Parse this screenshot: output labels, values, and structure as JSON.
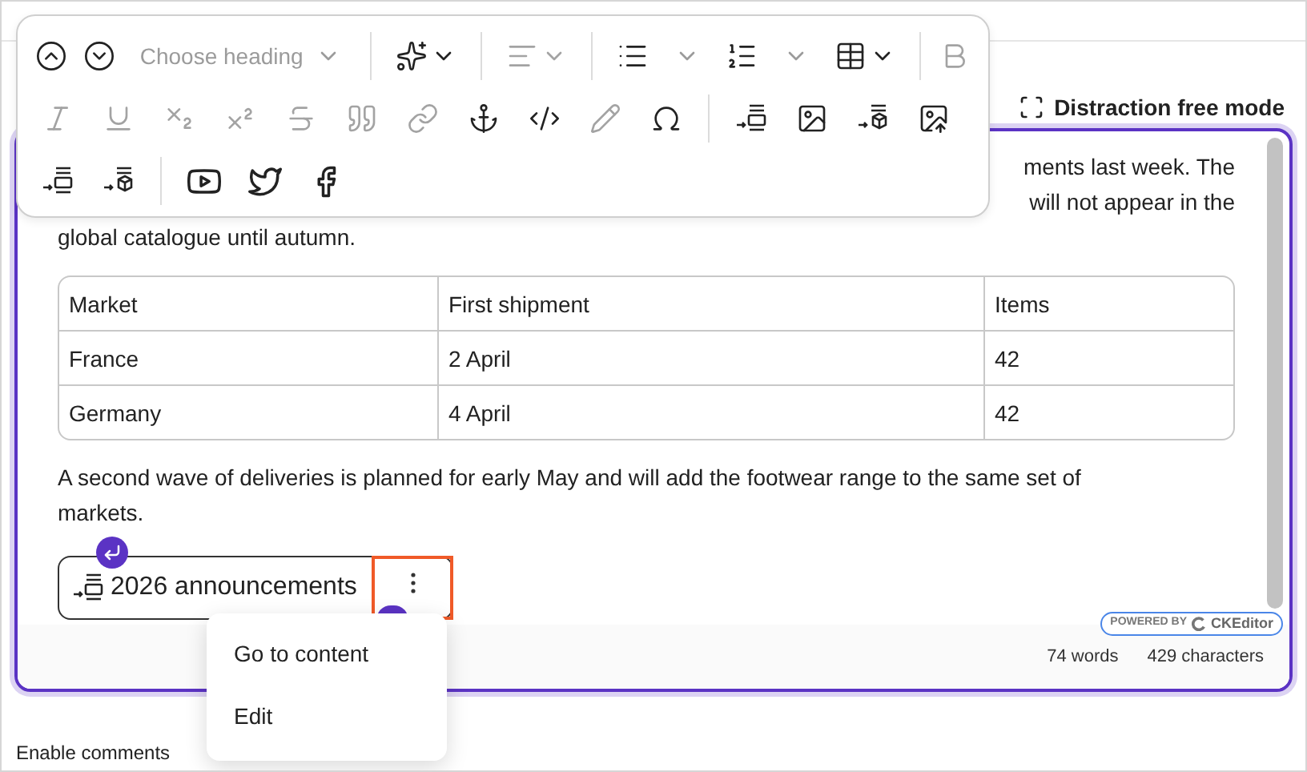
{
  "toolbar": {
    "rows": [
      [
        {
          "kind": "previous",
          "disabled": false
        },
        {
          "kind": "next",
          "disabled": false
        },
        {
          "kind": "heading",
          "placeholder": "Choose heading",
          "disabled": true
        },
        {
          "kind": "separator"
        },
        {
          "kind": "ai",
          "disabled": false
        },
        {
          "kind": "separator"
        },
        {
          "kind": "align",
          "disabled": true
        },
        {
          "kind": "separator"
        },
        {
          "kind": "bulleted-list",
          "disabled": false
        },
        {
          "kind": "numbered-list",
          "disabled": false
        },
        {
          "kind": "table",
          "disabled": false
        },
        {
          "kind": "separator"
        },
        {
          "kind": "bold",
          "disabled": true
        }
      ],
      [
        {
          "kind": "italic",
          "disabled": true
        },
        {
          "kind": "underline",
          "disabled": true
        },
        {
          "kind": "subscript",
          "disabled": true
        },
        {
          "kind": "superscript",
          "disabled": true
        },
        {
          "kind": "strikethrough",
          "disabled": true
        },
        {
          "kind": "quote",
          "disabled": true
        },
        {
          "kind": "link",
          "disabled": true
        },
        {
          "kind": "anchor",
          "disabled": false
        },
        {
          "kind": "code",
          "disabled": false
        },
        {
          "kind": "edit",
          "disabled": true
        },
        {
          "kind": "special-characters",
          "disabled": false
        },
        {
          "kind": "separator"
        },
        {
          "kind": "insert-section",
          "disabled": false
        },
        {
          "kind": "image",
          "disabled": false
        },
        {
          "kind": "insert-block",
          "disabled": false
        },
        {
          "kind": "upload-image",
          "disabled": false
        }
      ],
      [
        {
          "kind": "insert-section-inline",
          "disabled": false
        },
        {
          "kind": "insert-block-inline",
          "disabled": false
        },
        {
          "kind": "separator"
        },
        {
          "kind": "media",
          "disabled": false
        },
        {
          "kind": "twitter",
          "disabled": false
        },
        {
          "kind": "facebook",
          "disabled": false
        }
      ]
    ]
  },
  "distraction_free_button": "Distraction free mode",
  "content": {
    "paragraph_fragments": [
      "ments last week. The",
      "will not appear in the",
      "global catalogue until autumn."
    ],
    "table": {
      "columns": [
        "Market",
        "First shipment",
        "Items"
      ],
      "rows": [
        [
          "France",
          "2 April",
          "42"
        ],
        [
          "Germany",
          "4 April",
          "42"
        ]
      ]
    },
    "paragraph": "A second wave of deliveries is planned for early May and will add the footwear range to the same set of markets.",
    "widget": {
      "title": "2026 announcements",
      "selected": true
    }
  },
  "powered_by": {
    "label": "POWERED BY",
    "brand": "CKEditor"
  },
  "footer": {
    "words": "74 words",
    "characters": "429 characters"
  },
  "context_menu": [
    "Go to content",
    "Edit"
  ],
  "enable_comments": "Enable comments"
}
